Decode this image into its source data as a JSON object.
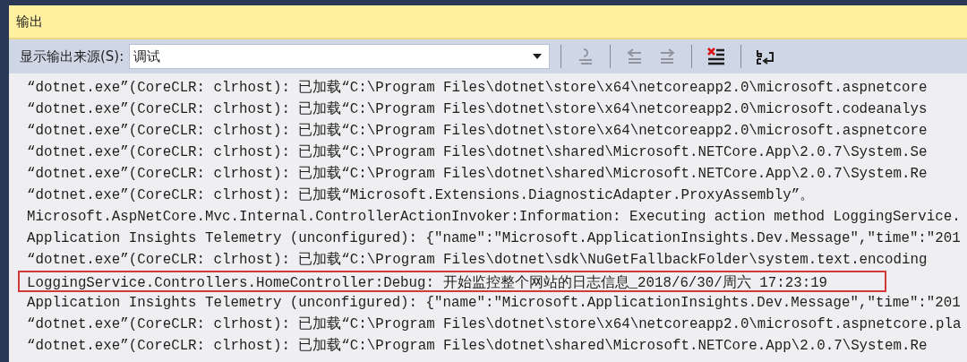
{
  "panel": {
    "title": "输出"
  },
  "toolbar": {
    "source_label": "显示输出来源(S):",
    "source": {
      "value": "调试"
    },
    "buttons": [
      {
        "kind": "find-message",
        "disabled": true
      },
      {
        "kind": "previous",
        "disabled": true
      },
      {
        "kind": "next",
        "disabled": true
      },
      {
        "kind": "clear",
        "disabled": false
      },
      {
        "kind": "wrap",
        "disabled": false
      }
    ]
  },
  "lines": [
    {
      "text": "“dotnet.exe”(CoreCLR: clrhost): 已加载“C:\\Program Files\\dotnet\\store\\x64\\netcoreapp2.0\\microsoft.aspnetcore",
      "highlighted": false
    },
    {
      "text": "“dotnet.exe”(CoreCLR: clrhost): 已加载“C:\\Program Files\\dotnet\\store\\x64\\netcoreapp2.0\\microsoft.codeanalys",
      "highlighted": false
    },
    {
      "text": "“dotnet.exe”(CoreCLR: clrhost): 已加载“C:\\Program Files\\dotnet\\store\\x64\\netcoreapp2.0\\microsoft.aspnetcore",
      "highlighted": false
    },
    {
      "text": "“dotnet.exe”(CoreCLR: clrhost): 已加载“C:\\Program Files\\dotnet\\shared\\Microsoft.NETCore.App\\2.0.7\\System.Se",
      "highlighted": false
    },
    {
      "text": "“dotnet.exe”(CoreCLR: clrhost): 已加载“C:\\Program Files\\dotnet\\shared\\Microsoft.NETCore.App\\2.0.7\\System.Re",
      "highlighted": false
    },
    {
      "text": "“dotnet.exe”(CoreCLR: clrhost): 已加载“Microsoft.Extensions.DiagnosticAdapter.ProxyAssembly”。",
      "highlighted": false
    },
    {
      "text": "Microsoft.AspNetCore.Mvc.Internal.ControllerActionInvoker:Information: Executing action method LoggingService.",
      "highlighted": false
    },
    {
      "text": "Application Insights Telemetry (unconfigured): {\"name\":\"Microsoft.ApplicationInsights.Dev.Message\",\"time\":\"201",
      "highlighted": false
    },
    {
      "text": "“dotnet.exe”(CoreCLR: clrhost): 已加载“C:\\Program Files\\dotnet\\sdk\\NuGetFallbackFolder\\system.text.encoding",
      "highlighted": false
    },
    {
      "text": "LoggingService.Controllers.HomeController:Debug: 开始监控整个网站的日志信息_2018/6/30/周六 17:23:19",
      "highlighted": true
    },
    {
      "text": "Application Insights Telemetry (unconfigured): {\"name\":\"Microsoft.ApplicationInsights.Dev.Message\",\"time\":\"201",
      "highlighted": false
    },
    {
      "text": "“dotnet.exe”(CoreCLR: clrhost): 已加载“C:\\Program Files\\dotnet\\store\\x64\\netcoreapp2.0\\microsoft.aspnetcore.pla",
      "highlighted": false
    },
    {
      "text": "“dotnet.exe”(CoreCLR: clrhost): 已加载“C:\\Program Files\\dotnet\\shared\\Microsoft.NETCore.App\\2.0.7\\System.Re",
      "highlighted": false
    }
  ]
}
